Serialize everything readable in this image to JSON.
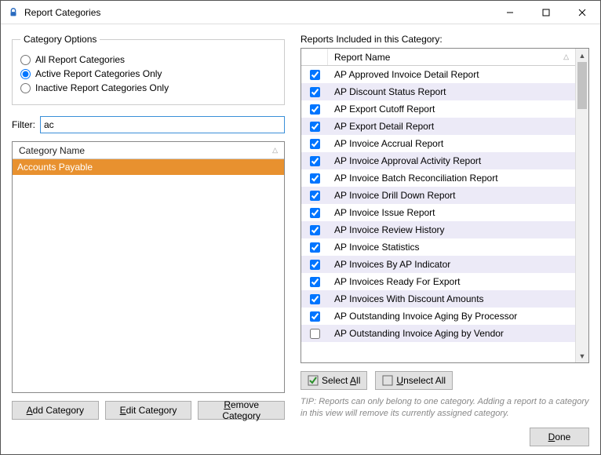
{
  "window": {
    "title": "Report Categories"
  },
  "options": {
    "legend": "Category Options",
    "radios": {
      "all": "All Report Categories",
      "active": "Active Report Categories Only",
      "inactive": "Inactive Report Categories Only"
    },
    "selected": "active"
  },
  "filter": {
    "label": "Filter:",
    "value": "ac"
  },
  "category_list": {
    "header": "Category Name",
    "items": [
      "Accounts Payable"
    ],
    "selected_index": 0
  },
  "category_buttons": {
    "add": "Add Category",
    "edit": "Edit Category",
    "remove": "Remove Category"
  },
  "reports": {
    "label": "Reports Included in this Category:",
    "header": "Report Name",
    "rows": [
      {
        "name": "AP Approved Invoice Detail Report",
        "checked": true
      },
      {
        "name": "AP Discount Status Report",
        "checked": true
      },
      {
        "name": "AP Export Cutoff Report",
        "checked": true
      },
      {
        "name": "AP Export Detail Report",
        "checked": true
      },
      {
        "name": "AP Invoice Accrual Report",
        "checked": true
      },
      {
        "name": "AP Invoice Approval Activity Report",
        "checked": true
      },
      {
        "name": "AP Invoice Batch Reconciliation Report",
        "checked": true
      },
      {
        "name": "AP Invoice Drill Down Report",
        "checked": true
      },
      {
        "name": "AP Invoice Issue Report",
        "checked": true
      },
      {
        "name": "AP Invoice Review History",
        "checked": true
      },
      {
        "name": "AP Invoice Statistics",
        "checked": true
      },
      {
        "name": "AP Invoices By AP Indicator",
        "checked": true
      },
      {
        "name": "AP Invoices Ready For Export",
        "checked": true
      },
      {
        "name": "AP Invoices With Discount Amounts",
        "checked": true
      },
      {
        "name": "AP Outstanding Invoice Aging By Processor",
        "checked": true
      },
      {
        "name": "AP Outstanding Invoice Aging by Vendor",
        "checked": false
      }
    ]
  },
  "select_buttons": {
    "select_all": "Select All",
    "unselect_all": "Unselect All"
  },
  "tip": "TIP:  Reports can only belong to one category.  Adding a report to a category in this view will remove its currently assigned category.",
  "done": "Done"
}
